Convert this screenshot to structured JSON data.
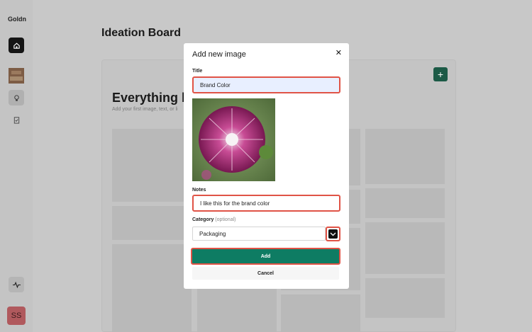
{
  "app": {
    "logo": "Goldn"
  },
  "sidebar": {
    "items": [
      {
        "icon": "home-icon"
      },
      {
        "icon": "image-thumbnail"
      },
      {
        "icon": "lightbulb-icon"
      },
      {
        "icon": "clipboard-check-icon"
      }
    ],
    "activity_icon": "activity-icon",
    "avatar_initials": "SS"
  },
  "page": {
    "title": "Ideation Board"
  },
  "board": {
    "heading": "Everything be",
    "subtext": "Add your first image, text, or li",
    "add_icon": "+"
  },
  "modal": {
    "title": "Add new image",
    "close_icon": "✕",
    "title_label": "Title",
    "title_value": "Brand Color",
    "notes_label": "Notes",
    "notes_value": "I like this for the brand color",
    "category_label": "Category",
    "category_optional": "(optional)",
    "category_value": "Packaging",
    "add_label": "Add",
    "cancel_label": "Cancel"
  },
  "colors": {
    "accent": "#0e7c63",
    "highlight": "#e05346",
    "avatar": "#b0595d",
    "board_plus": "#1c5a46"
  }
}
